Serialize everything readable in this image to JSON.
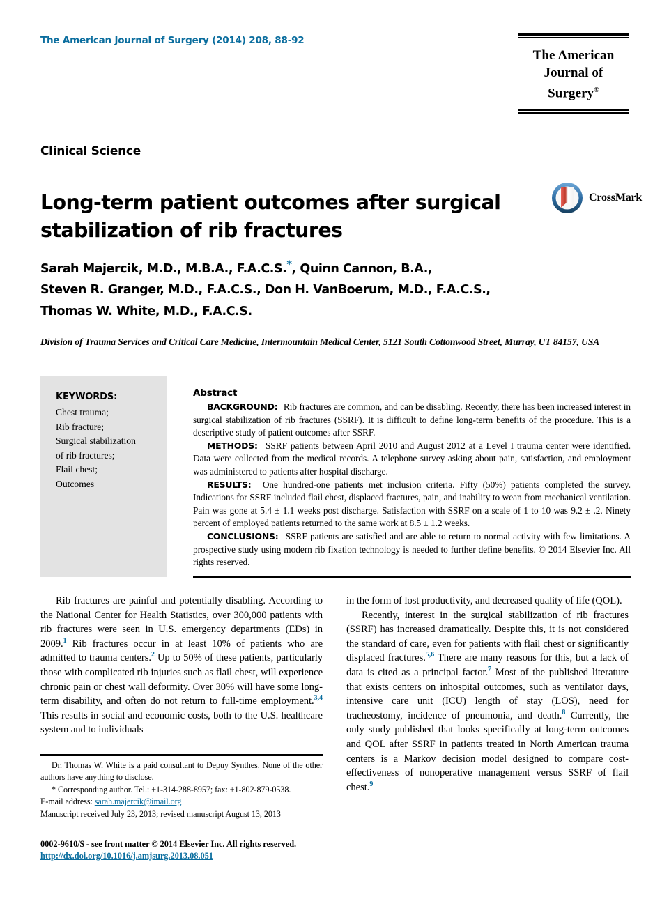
{
  "header": {
    "journal_reference": "The American Journal of Surgery (2014) 208, 88-92",
    "logo_line_1": "The American",
    "logo_line_2": "Journal of Surgery",
    "logo_registered_mark": "®"
  },
  "article": {
    "section_label": "Clinical Science",
    "title": "Long-term patient outcomes after surgical stabilization of rib fractures",
    "crossmark_label": "CrossMark",
    "authors_line_1_a": "Sarah Majercik, M.D., M.B.A., F.A.C.S.",
    "authors_star": "*",
    "authors_line_1_b": ", Quinn Cannon, B.A.,",
    "authors_line_2": "Steven R. Granger, M.D., F.A.C.S., Don H. VanBoerum, M.D., F.A.C.S.,",
    "authors_line_3": "Thomas W. White, M.D., F.A.C.S.",
    "affiliation": "Division of Trauma Services and Critical Care Medicine, Intermountain Medical Center, 5121 South Cottonwood Street, Murray, UT 84157, USA"
  },
  "keywords": {
    "title": "KEYWORDS:",
    "items": [
      "Chest trauma;",
      "Rib fracture;",
      "Surgical stabilization",
      "of rib fractures;",
      "Flail chest;",
      "Outcomes"
    ]
  },
  "abstract": {
    "title": "Abstract",
    "sections": [
      {
        "heading": "BACKGROUND:",
        "text": "Rib fractures are common, and can be disabling. Recently, there has been increased interest in surgical stabilization of rib fractures (SSRF). It is difficult to define long-term benefits of the procedure. This is a descriptive study of patient outcomes after SSRF."
      },
      {
        "heading": "METHODS:",
        "text": "SSRF patients between April 2010 and August 2012 at a Level I trauma center were identified. Data were collected from the medical records. A telephone survey asking about pain, satisfaction, and employment was administered to patients after hospital discharge."
      },
      {
        "heading": "RESULTS:",
        "text": "One hundred-one patients met inclusion criteria. Fifty (50%) patients completed the survey. Indications for SSRF included flail chest, displaced fractures, pain, and inability to wean from mechanical ventilation. Pain was gone at 5.4 ± 1.1 weeks post discharge. Satisfaction with SSRF on a scale of 1 to 10 was 9.2 ± .2. Ninety percent of employed patients returned to the same work at 8.5 ± 1.2 weeks."
      },
      {
        "heading": "CONCLUSIONS:",
        "text": "SSRF patients are satisfied and are able to return to normal activity with few limitations. A prospective study using modern rib fixation technology is needed to further define benefits. © 2014 Elsevier Inc. All rights reserved."
      }
    ]
  },
  "body": {
    "left_column": {
      "p1_part1": "Rib fractures are painful and potentially disabling. According to the National Center for Health Statistics, over 300,000 patients with rib fractures were seen in U.S. emergency departments (EDs) in 2009.",
      "p1_cite1": "1",
      "p1_part2": " Rib fractures occur in at least 10% of patients who are admitted to trauma centers.",
      "p1_cite2": "2",
      "p1_part3": " Up to 50% of these patients, particularly those with complicated rib injuries such as flail chest, will experience chronic pain or chest wall deformity. Over 30% will have some long-term disability, and often do not return to full-time employment.",
      "p1_cite3": "3,4",
      "p1_part4": " This results in social and economic costs, both to the U.S. healthcare system and to individuals"
    },
    "right_column": {
      "p1_cont": "in the form of lost productivity, and decreased quality of life (QOL).",
      "p2_part1": "Recently, interest in the surgical stabilization of rib fractures (SSRF) has increased dramatically. Despite this, it is not considered the standard of care, even for patients with flail chest or significantly displaced fractures.",
      "p2_cite1": "5,6",
      "p2_part2": " There are many reasons for this, but a lack of data is cited as a principal factor.",
      "p2_cite2": "7",
      "p2_part3": " Most of the published literature that exists centers on inhospital outcomes, such as ventilator days, intensive care unit (ICU) length of stay (LOS), need for tracheostomy, incidence of pneumonia, and death.",
      "p2_cite3": "8",
      "p2_part4": " Currently, the only study published that looks specifically at long-term outcomes and QOL after SSRF in patients treated in North American trauma centers is a Markov decision model designed to compare cost-effectiveness of nonoperative management versus SSRF of flail chest.",
      "p2_cite4": "9"
    }
  },
  "footnotes": {
    "disclosure": "Dr. Thomas W. White is a paid consultant to Depuy Synthes. None of the other authors have anything to disclose.",
    "corresponding": "* Corresponding author. Tel.: +1-314-288-8957; fax: +1-802-879-0538.",
    "email_label": "E-mail address: ",
    "email": "sarah.majercik@imail.org",
    "manuscript": "Manuscript received July 23, 2013; revised manuscript August 13, 2013"
  },
  "bottom": {
    "issn": "0002-9610/$ - see front matter © 2014 Elsevier Inc. All rights reserved.",
    "doi": "http://dx.doi.org/10.1016/j.amjsurg.2013.08.051"
  },
  "colors": {
    "accent_blue": "#0a6d9e",
    "keywords_background": "#e3e3e3",
    "crossmark_blue": "#2e6da4",
    "crossmark_red": "#c0392b"
  }
}
